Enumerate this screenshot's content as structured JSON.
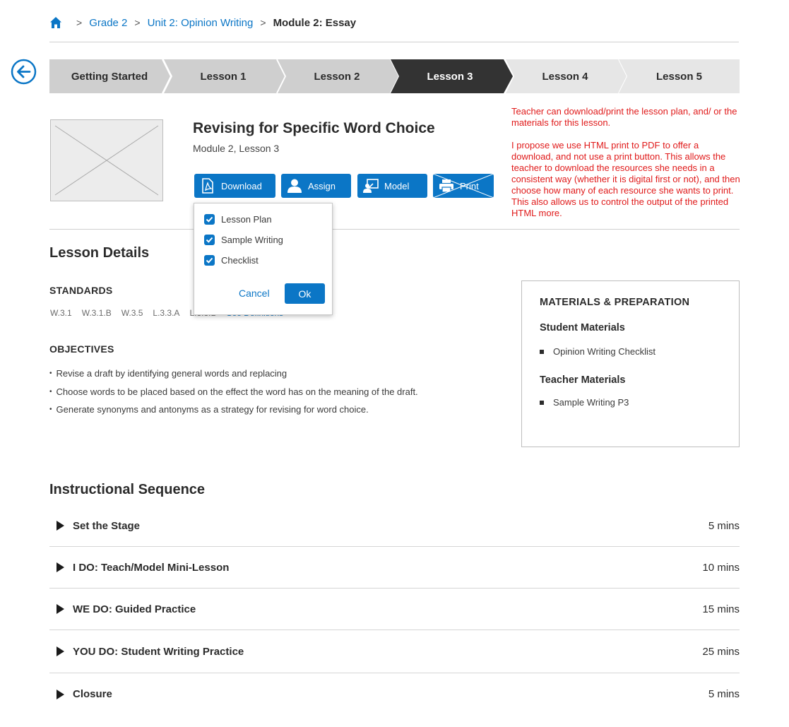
{
  "breadcrumb": {
    "items": [
      "Grade 2",
      "Unit 2: Opinion Writing"
    ],
    "current": "Module 2: Essay",
    "separator": ">"
  },
  "stepper": {
    "steps": [
      "Getting Started",
      "Lesson 1",
      "Lesson 2",
      "Lesson 3",
      "Lesson 4",
      "Lesson 5"
    ],
    "active": "Lesson 3"
  },
  "lesson": {
    "title": "Revising for Specific Word Choice",
    "subtitle": "Module 2, Lesson 3"
  },
  "actions": {
    "download": "Download",
    "assign": "Assign",
    "model": "Model",
    "print": "Print"
  },
  "dropdown": {
    "options": [
      "Lesson Plan",
      "Sample Writing",
      "Checklist"
    ],
    "checked": [
      true,
      true,
      true
    ],
    "cancel": "Cancel",
    "ok": "Ok"
  },
  "note": {
    "p1": "Teacher can download/print the lesson plan, and/ or the materials for this lesson.",
    "p2": "I propose we use HTML print to PDF to offer a download, and not use a print button. This allows the teacher to download the resources she needs in a consistent way (whether it is digital first or not), and then choose how many of each resource she wants to print. This also allows us to control the output of the printed HTML more."
  },
  "details": {
    "heading": "Lesson Details",
    "standards_heading": "STANDARDS",
    "standards": [
      "W.3.1",
      "W.3.1.B",
      "W.3.5",
      "L.3.3.A",
      "L.3.3.B"
    ],
    "see_definitions": "See Definitions",
    "objectives_heading": "OBJECTIVES",
    "objectives": [
      "Revise a draft by identifying general words and replacing",
      "Choose words to be placed based on the effect the word has on the meaning of the draft.",
      "Generate synonyms and antonyms as a strategy for revising for word choice."
    ]
  },
  "materials": {
    "heading": "MATERIALS & PREPARATION",
    "student_heading": "Student Materials",
    "student_items": [
      "Opinion Writing Checklist"
    ],
    "teacher_heading": "Teacher Materials",
    "teacher_items": [
      "Sample Writing P3"
    ]
  },
  "sequence": {
    "heading": "Instructional Sequence",
    "rows": [
      {
        "label": "Set the Stage",
        "time": "5 mins"
      },
      {
        "label": "I DO: Teach/Model Mini-Lesson",
        "time": "10 mins"
      },
      {
        "label": "WE DO: Guided Practice",
        "time": "15 mins"
      },
      {
        "label": "YOU DO: Student Writing Practice",
        "time": "25 mins"
      },
      {
        "label": "Closure",
        "time": "5 mins"
      }
    ]
  },
  "colors": {
    "accent": "#0b76c6",
    "step_inactive": "#cfcfcf",
    "step_future": "#e6e6e6",
    "step_active": "#333333",
    "note_red": "#e01a1a"
  }
}
